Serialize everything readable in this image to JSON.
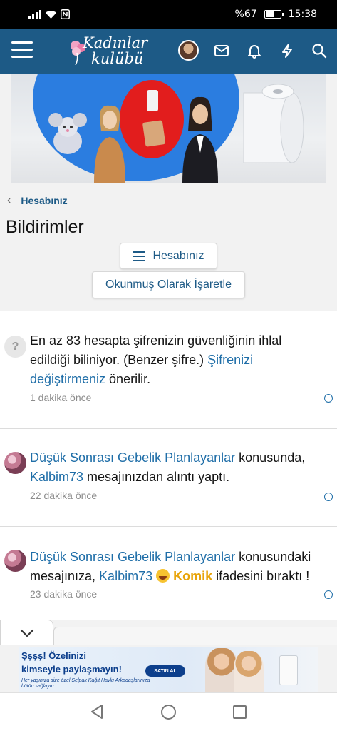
{
  "status_bar": {
    "battery": "%67",
    "time": "15:38"
  },
  "header": {
    "logo_line1": "Kadınlar",
    "logo_line2": "kulübü"
  },
  "breadcrumb": {
    "label": "Hesabınız"
  },
  "page": {
    "title": "Bildirimler"
  },
  "buttons": {
    "account": "Hesabınız",
    "mark_read": "Okunmuş Olarak İşaretle"
  },
  "notifications": [
    {
      "text_a": "En az 83 hesapta şifrenizin güvenliğinin ihlal edildiği biliniyor. (Benzer şifre.) ",
      "link": "Şifrenizi değiştirmeniz",
      "text_b": " önerilir.",
      "time": "1 dakika önce"
    },
    {
      "thread": "Düşük Sonrası Gebelik Planlayanlar",
      "text_a": " konusunda, ",
      "user": "Kalbim73",
      "text_b": " mesajınızdan alıntı yaptı.",
      "time": "22 dakika önce"
    },
    {
      "thread": "Düşük Sonrası Gebelik Planlayanlar",
      "text_a": " konusundaki mesajınıza, ",
      "user": "Kalbim73",
      "reaction": "Komik",
      "text_b": " ifadesini bıraktı !",
      "time": "23 dakika önce"
    }
  ],
  "ad": {
    "line1": "Şşşş! Özelinizi",
    "line2": "kimseyle paylaşmayın!",
    "line3": "Her yaşınıza size özel Selpak Kağıt Havlu Arkadaşlarınıza bütün sağlayın.",
    "cta": "SATIN AL"
  },
  "colors": {
    "header": "#1d5a86",
    "link": "#1f6ea8",
    "reaction": "#e8a40a"
  }
}
